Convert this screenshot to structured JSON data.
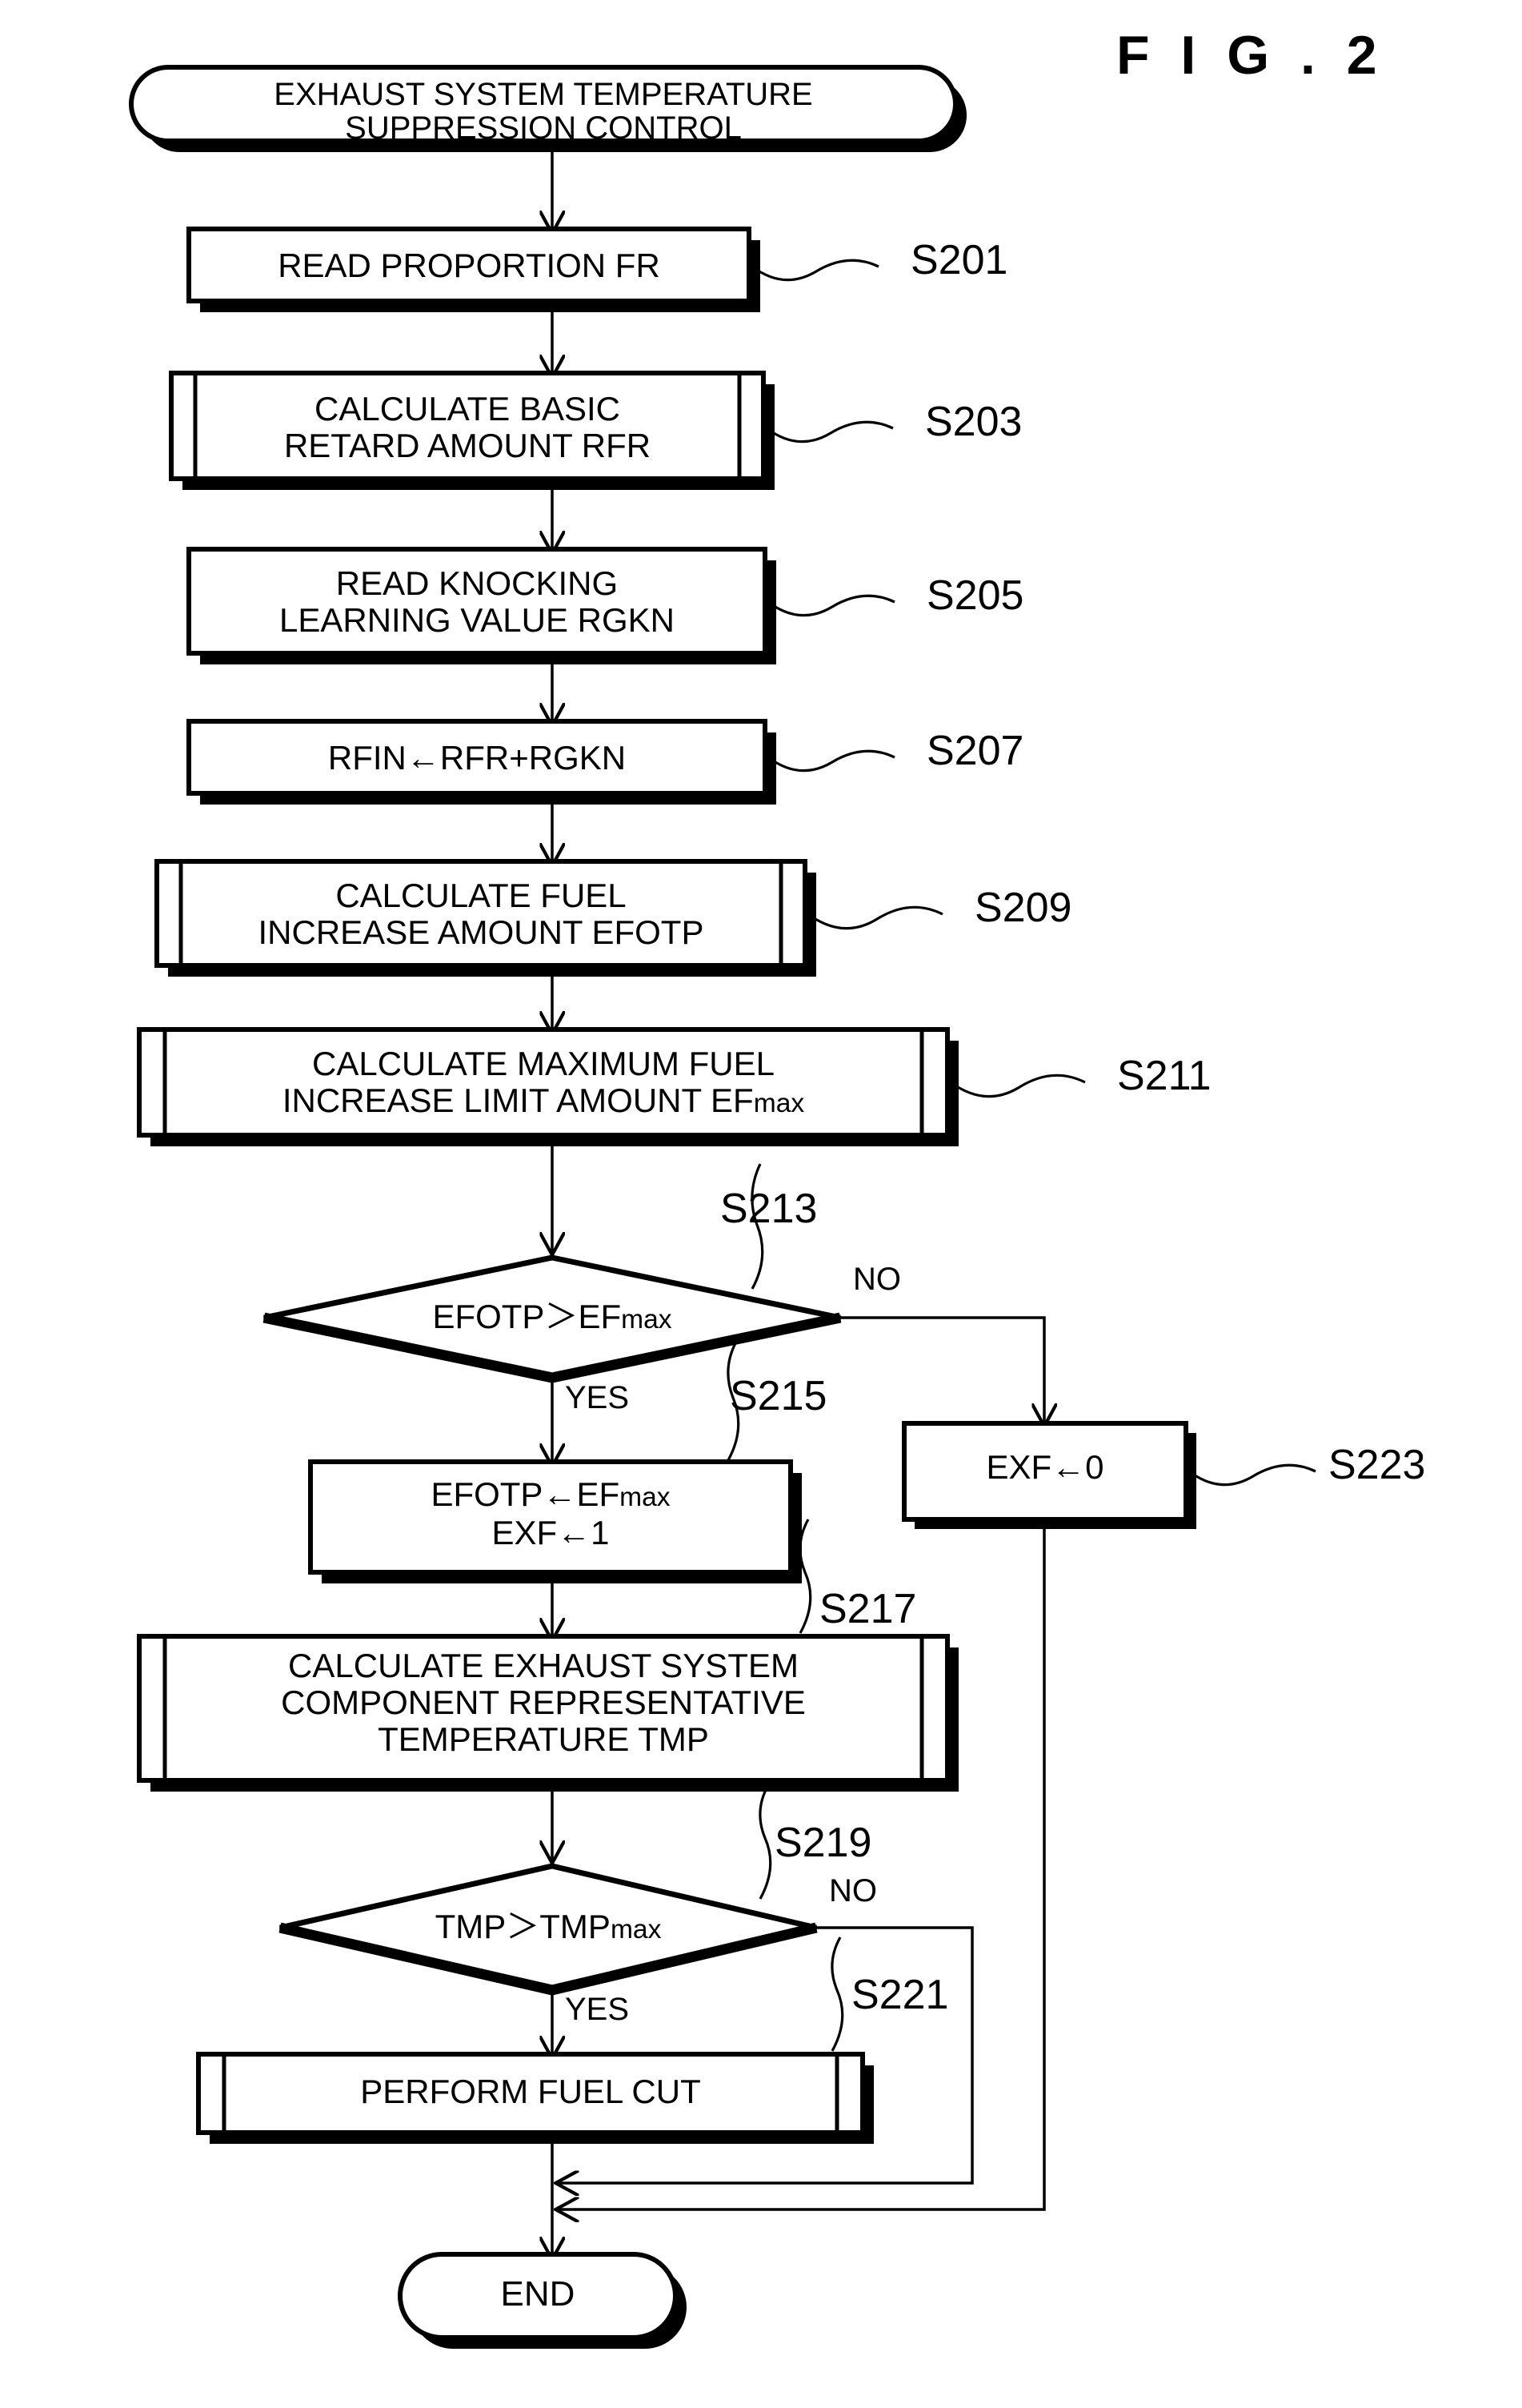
{
  "figure": {
    "label": "F I G . 2"
  },
  "flowchart": {
    "start": {
      "line1": "EXHAUST SYSTEM TEMPERATURE",
      "line2": "SUPPRESSION CONTROL"
    },
    "end": {
      "label": "END"
    },
    "nodes": [
      {
        "id": "S201",
        "step": "S201",
        "shape": "process",
        "lines": [
          "READ PROPORTION FR"
        ]
      },
      {
        "id": "S203",
        "step": "S203",
        "shape": "predefined-process",
        "lines": [
          "CALCULATE BASIC",
          "RETARD AMOUNT RFR"
        ]
      },
      {
        "id": "S205",
        "step": "S205",
        "shape": "process",
        "lines": [
          "READ KNOCKING",
          "LEARNING VALUE RGKN"
        ]
      },
      {
        "id": "S207",
        "step": "S207",
        "shape": "process",
        "lines": [
          "RFIN←RFR+RGKN"
        ]
      },
      {
        "id": "S209",
        "step": "S209",
        "shape": "predefined-process",
        "lines": [
          "CALCULATE FUEL",
          "INCREASE AMOUNT EFOTP"
        ]
      },
      {
        "id": "S211",
        "step": "S211",
        "shape": "predefined-process",
        "lines": [
          "CALCULATE MAXIMUM FUEL",
          "INCREASE LIMIT AMOUNT EFmax"
        ]
      },
      {
        "id": "S213",
        "step": "S213",
        "shape": "decision",
        "lines": [
          "EFOTP＞EFmax"
        ],
        "yes": "YES",
        "no": "NO"
      },
      {
        "id": "S215",
        "step": "S215",
        "shape": "process",
        "lines": [
          "EFOTP←EFmax",
          "EXF←1"
        ]
      },
      {
        "id": "S217",
        "step": "S217",
        "shape": "predefined-process",
        "lines": [
          "CALCULATE EXHAUST SYSTEM",
          "COMPONENT REPRESENTATIVE",
          "TEMPERATURE TMP"
        ]
      },
      {
        "id": "S219",
        "step": "S219",
        "shape": "decision",
        "lines": [
          "TMP＞TMPmax"
        ],
        "yes": "YES",
        "no": "NO"
      },
      {
        "id": "S221",
        "step": "S221",
        "shape": "predefined-process",
        "lines": [
          "PERFORM FUEL CUT"
        ]
      },
      {
        "id": "S223",
        "step": "S223",
        "shape": "process",
        "lines": [
          "EXF←0"
        ]
      }
    ]
  }
}
